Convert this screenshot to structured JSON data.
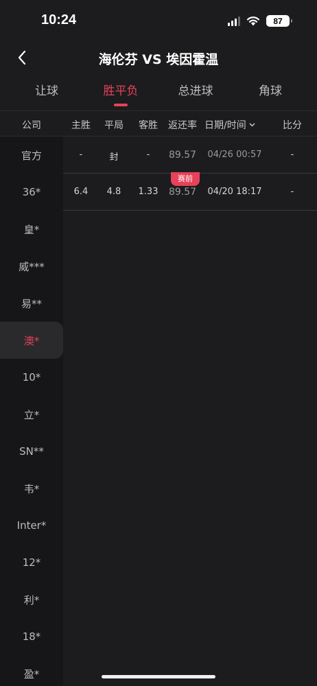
{
  "status": {
    "time": "10:24",
    "battery": "87"
  },
  "nav": {
    "title": "海伦芬 VS 埃因霍温"
  },
  "tabs": [
    {
      "label": "让球"
    },
    {
      "label": "胜平负"
    },
    {
      "label": "总进球"
    },
    {
      "label": "角球"
    }
  ],
  "headers": {
    "company": "公司",
    "home": "主胜",
    "draw": "平局",
    "away": "客胜",
    "rate": "返还率",
    "datetime": "日期/时间",
    "score": "比分"
  },
  "companies": [
    "官方",
    "36*",
    "皇*",
    "威***",
    "易**",
    "澳*",
    "10*",
    "立*",
    "SN**",
    "韦*",
    "Inter*",
    "12*",
    "利*",
    "18*",
    "盈*"
  ],
  "rows": [
    {
      "home": "-",
      "draw": "封",
      "away": "-",
      "rate": "89.57",
      "datetime": "04/26 00:57",
      "score": "-"
    },
    {
      "badge": "赛前",
      "home": "6.4",
      "draw": "4.8",
      "away": "1.33",
      "rate": "89.57",
      "datetime": "04/20 18:17",
      "score": "-"
    }
  ],
  "colors": {
    "accent": "#e8415a",
    "background": "#1c1c1e"
  }
}
